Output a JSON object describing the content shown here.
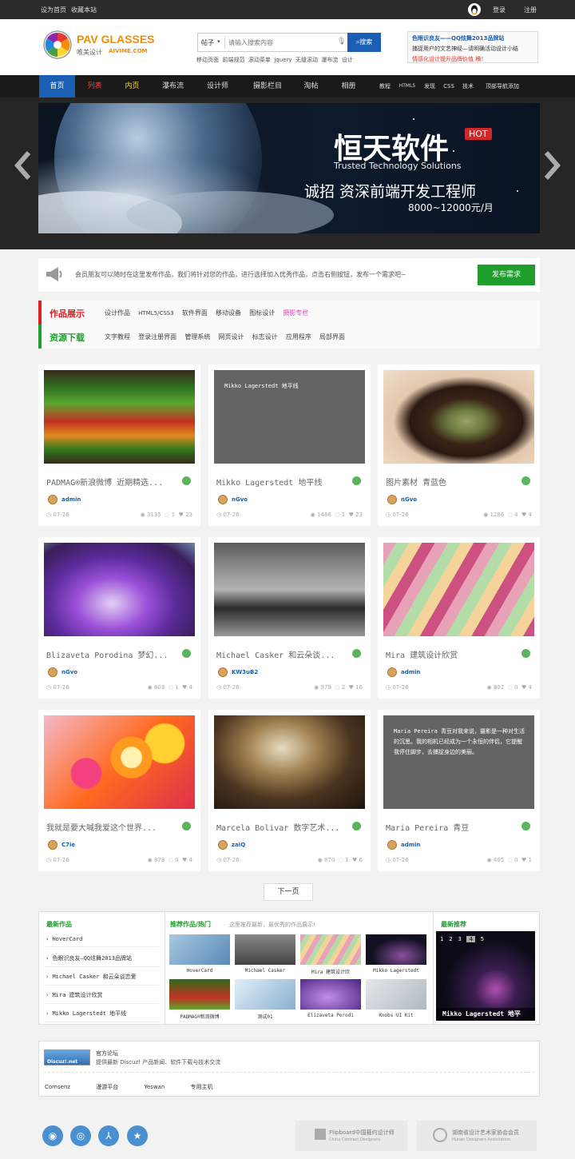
{
  "topbar": {
    "set_home": "设为首页",
    "bookmark": "收藏本站",
    "login": "登录",
    "register": "注册"
  },
  "logo": {
    "name": "PAV GLASSES",
    "sub_cn": "唯美设计",
    "sub_en": "AIVIME.COM"
  },
  "search": {
    "type": "帖子",
    "placeholder": "请输入搜索内容",
    "button": "搜索",
    "hot": [
      "移动页面",
      "前端规范",
      "滚动菜单",
      "jquery",
      "无缝滚动",
      "瀑布流",
      "设计"
    ]
  },
  "promo": {
    "title": "色眼识良友——QQ炫舞2013品牌站",
    "line2": "捕捉用户的文艺神经—请明确活动设计小结",
    "line3": "情感化设计提升品牌价值 稿！"
  },
  "nav": {
    "items": [
      "首页",
      "列表",
      "内页",
      "瀑布流",
      "设计师",
      "摄影栏目",
      "淘帖",
      "相册"
    ],
    "right": [
      "教程",
      "HTML5",
      "发现",
      "CSS",
      "技术",
      "顶部导航添加"
    ]
  },
  "banner": {
    "title": "恒天软件",
    "hot": "HOT",
    "subtitle": "Trusted Technology Solutions",
    "line1": "诚招 资深前端开发工程师",
    "line2": "8000~12000元/月"
  },
  "notice": {
    "text": "会员朋友可以随时在这里发布作品，我们将针对您的作品，进行选择加入优秀作品，点击右侧按钮，发布一个需求吧~",
    "button": "发布需求"
  },
  "categories": {
    "works_label": "作品展示",
    "works": [
      "设计作品",
      "HTML5/CSS3",
      "软件界面",
      "移动设备",
      "图标设计",
      "摄影专栏"
    ],
    "res_label": "资源下载",
    "res": [
      "文字教程",
      "登录注册界面",
      "管理系统",
      "网页设计",
      "标志设计",
      "应用程序",
      "局部界面"
    ]
  },
  "cards": [
    {
      "title": "PADMAG®新浪微博 近期精选...",
      "author": "admin",
      "date": "07-26",
      "views": "3135",
      "replies": "1",
      "likes": "23",
      "img": "market"
    },
    {
      "title": "Mikko Lagerstedt 地平线",
      "author": "nGvo",
      "date": "07-26",
      "views": "1486",
      "replies": "1",
      "likes": "23",
      "img": "grey",
      "overlay": "Mikko Lagerstedt 地平线"
    },
    {
      "title": "图片素材 青蓝色",
      "author": "nGvo",
      "date": "07-26",
      "views": "1286",
      "replies": "4",
      "likes": "4",
      "img": "hair"
    },
    {
      "title": "Blizaveta Porodina 梦幻...",
      "author": "nGvo",
      "date": "07-26",
      "views": "803",
      "replies": "1",
      "likes": "4",
      "img": "purple"
    },
    {
      "title": "Michael Casker 和云朵谈...",
      "author": "KW3uB2",
      "date": "07-26",
      "views": "979",
      "replies": "2",
      "likes": "10",
      "img": "bw"
    },
    {
      "title": "Mira 建筑设计欣赏",
      "author": "admin",
      "date": "07-26",
      "views": "802",
      "replies": "0",
      "likes": "4",
      "img": "arch"
    },
    {
      "title": "我就是要大喊我爱这个世界...",
      "author": "C7ie",
      "date": "07-26",
      "views": "878",
      "replies": "0",
      "likes": "4",
      "img": "flowers"
    },
    {
      "title": "Marcela Bolivar 数字艺术...",
      "author": "zaiQ",
      "date": "07-26",
      "views": "870",
      "replies": "1",
      "likes": "6",
      "img": "art"
    },
    {
      "title": "Maria Pereira 青豆",
      "author": "admin",
      "date": "07-26",
      "views": "405",
      "replies": "0",
      "likes": "1",
      "img": "grey",
      "overlay": "Maria Pereira 青豆对我来说，摄影是一种对生活的沉思。我的相机已经成为一个永恒的伴侣，它提醒我停住脚步，去捕捉身边的美丽。"
    }
  ],
  "next_page": "下一页",
  "bottom": {
    "latest_title": "最新作品",
    "latest": [
      "HoverCard",
      "色眼识良友—QQ炫舞2013品牌站",
      "Michael Casker 和云朵谈恋爱",
      "Mira 建筑设计欣赏",
      "Mikko Lagerstedt 地平线"
    ],
    "rec_title": "推荐作品/热门",
    "rec_sub": "这里推荐最新，最优秀的作品展示!",
    "thumbs": [
      "HoverCard",
      "Michael Casker",
      "Mira 建筑设计欣",
      "Mikko Lagerstedt",
      "PADMAG®新浪微博",
      "测试01",
      "Elizaveta Porodi",
      "Knobs UI Kit"
    ],
    "new_title": "最新推荐",
    "slider_nums": [
      "1",
      "2",
      "3",
      "4",
      "5"
    ],
    "slider_caption": "Mikko Lagerstedt 地平"
  },
  "links": {
    "logo": "Discuz!.net",
    "title": "官方论坛",
    "desc": "提供最新 Discuz! 产品新闻、软件下载与技术交流",
    "items": [
      "Comsenz",
      "漫游平台",
      "Yeswan",
      "专用主机"
    ]
  },
  "footer": {
    "badge1": "Flipboard中国箍约设计师",
    "badge1_sub": "China Contract Designers",
    "badge2": "湖南省设计艺术家协会会员",
    "badge2_sub": "Hunan Designers Association"
  }
}
